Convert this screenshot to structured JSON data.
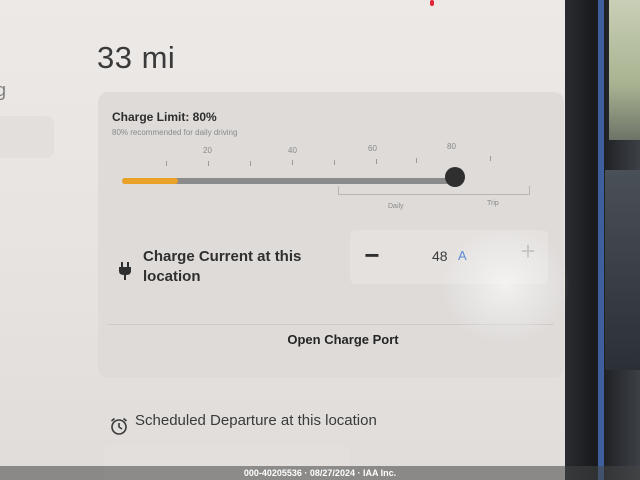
{
  "header": {
    "range": "33 mi"
  },
  "charge_limit": {
    "title": "Charge Limit: 80%",
    "subtitle": "80% recommended for daily driving",
    "value_percent": 80,
    "scale_labels": [
      "20",
      "40",
      "60",
      "80"
    ],
    "zone_labels": {
      "daily": "Daily",
      "trip": "Trip"
    }
  },
  "charge_current": {
    "label": "Charge Current at this location",
    "value": "48",
    "unit": "A",
    "minus_label": "−",
    "plus_label": "+"
  },
  "open_charge_port": {
    "label": "Open Charge Port"
  },
  "scheduled_departure": {
    "label": "Scheduled Departure at this location"
  },
  "caption": "000-40205536 · 08/27/2024 · IAA Inc.",
  "colors": {
    "accent": "#e9a127",
    "unit": "#4a7bd0"
  },
  "icons": {
    "charge_current": "plug-icon",
    "scheduled_departure": "alarm-clock-icon"
  }
}
